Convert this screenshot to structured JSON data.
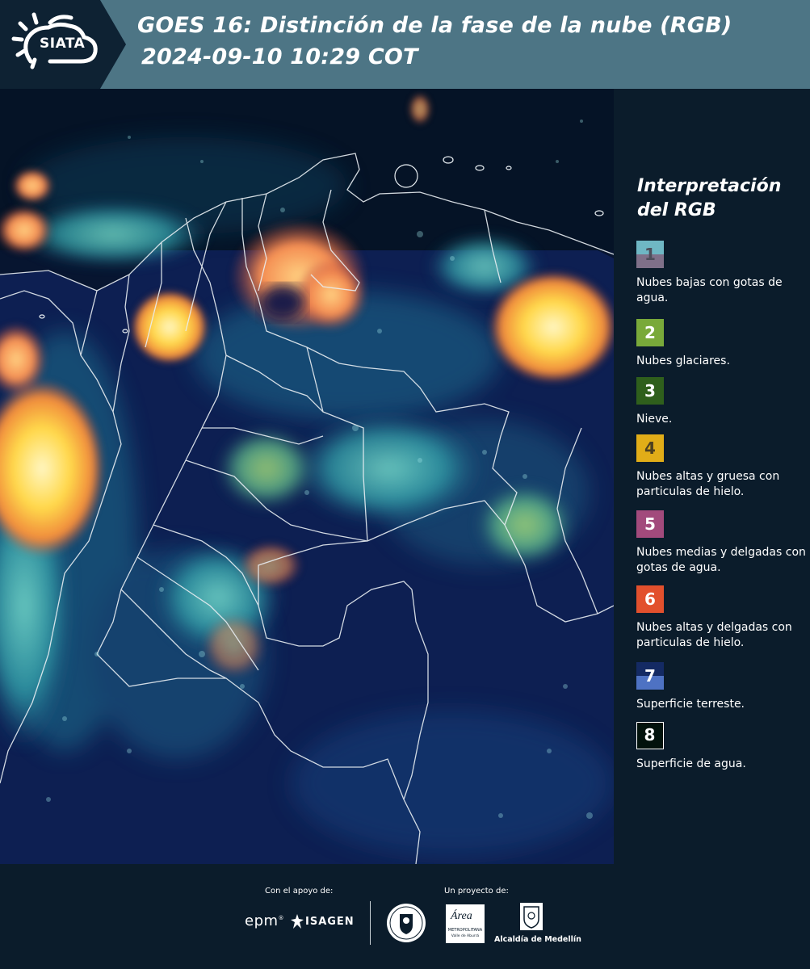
{
  "header": {
    "logo_text": "SIATA",
    "title_line1": "GOES 16: Distinción de la fase de la nube (RGB)",
    "title_line2": "2024-09-10 10:29 COT"
  },
  "legend": {
    "title": "Interpretación del RGB",
    "items": [
      {
        "number": "1",
        "label": "Nubes bajas con gotas de agua.",
        "color_top": "#6fb7c4",
        "color_bottom": "#7f7089"
      },
      {
        "number": "2",
        "label": "Nubes glaciares.",
        "color": "#79a93a"
      },
      {
        "number": "3",
        "label": "Nieve.",
        "color": "#2f5f1c"
      },
      {
        "number": "4",
        "label": "Nubes altas y gruesa con particulas de hielo.",
        "color": "#e1ad18"
      },
      {
        "number": "5",
        "label": "Nubes medias y delgadas con gotas de agua.",
        "color": "#a24a7c"
      },
      {
        "number": "6",
        "label": "Nubes altas y delgadas con particulas de hielo.",
        "color": "#e2502d"
      },
      {
        "number": "7",
        "label": "Superficie terreste.",
        "color_top": "#142a63",
        "color_bottom": "#4e72c3"
      },
      {
        "number": "8",
        "label": "Superficie de agua.",
        "color": "#02120c"
      }
    ]
  },
  "footer": {
    "support_label": "Con el apoyo de:",
    "project_label": "Un proyecto de:",
    "epm_text": "epm",
    "isagen_text": "ISAGEN",
    "area_text": "Área",
    "area_subtitle": "METROPOLITANA",
    "area_subtitle2": "Valle de Aburrá",
    "alcaldia_text": "Alcaldía de Medellín"
  }
}
